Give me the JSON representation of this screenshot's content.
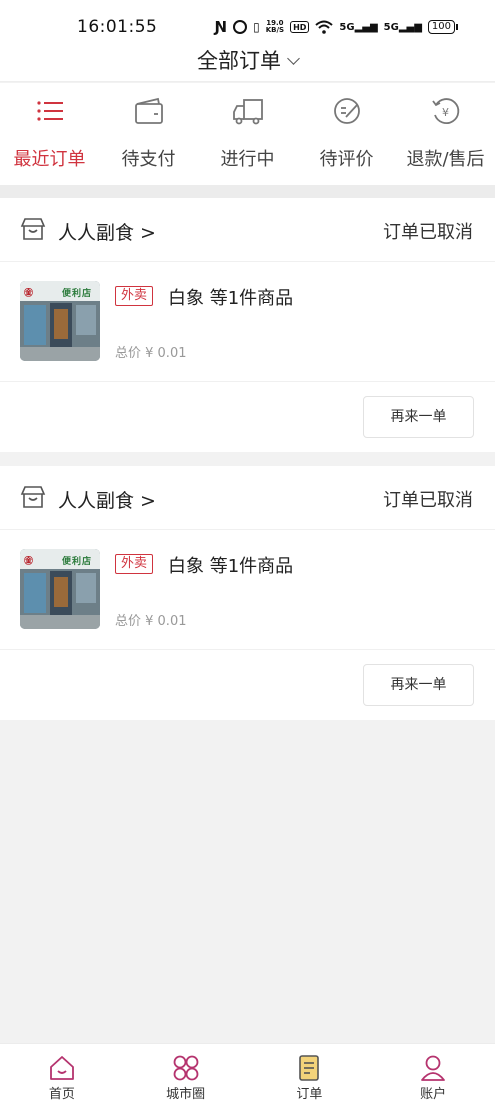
{
  "status_bar": {
    "time": "16:01:55",
    "speed_value": "19.0",
    "speed_unit": "KB/S",
    "hd": "HD",
    "signal1": "5G",
    "signal2": "5G",
    "battery": "100"
  },
  "header": {
    "title": "全部订单"
  },
  "tabs": [
    {
      "label": "最近订单",
      "icon": "list-icon",
      "active": true
    },
    {
      "label": "待支付",
      "icon": "wallet-icon",
      "active": false
    },
    {
      "label": "进行中",
      "icon": "truck-icon",
      "active": false
    },
    {
      "label": "待评价",
      "icon": "review-icon",
      "active": false
    },
    {
      "label": "退款/售后",
      "icon": "refund-icon",
      "active": false
    }
  ],
  "orders": [
    {
      "shop": "人人副食 >",
      "status": "订单已取消",
      "type": "外卖",
      "goods": "白象 等1件商品",
      "price": "总价 ¥ 0.01",
      "action": "再来一单",
      "thumb_sign_left": "㊎",
      "thumb_sign_right": "便利店"
    },
    {
      "shop": "人人副食 >",
      "status": "订单已取消",
      "type": "外卖",
      "goods": "白象 等1件商品",
      "price": "总价 ¥ 0.01",
      "action": "再来一单",
      "thumb_sign_left": "㊎",
      "thumb_sign_right": "便利店"
    }
  ],
  "bottom_nav": [
    {
      "label": "首页",
      "icon": "home-icon"
    },
    {
      "label": "城市圈",
      "icon": "city-circle-icon"
    },
    {
      "label": "订单",
      "icon": "order-icon"
    },
    {
      "label": "账户",
      "icon": "account-icon"
    }
  ],
  "colors": {
    "accent": "#d0343f",
    "nav_accent": "#b5336e",
    "order_icon_fill": "#f3d37a"
  }
}
